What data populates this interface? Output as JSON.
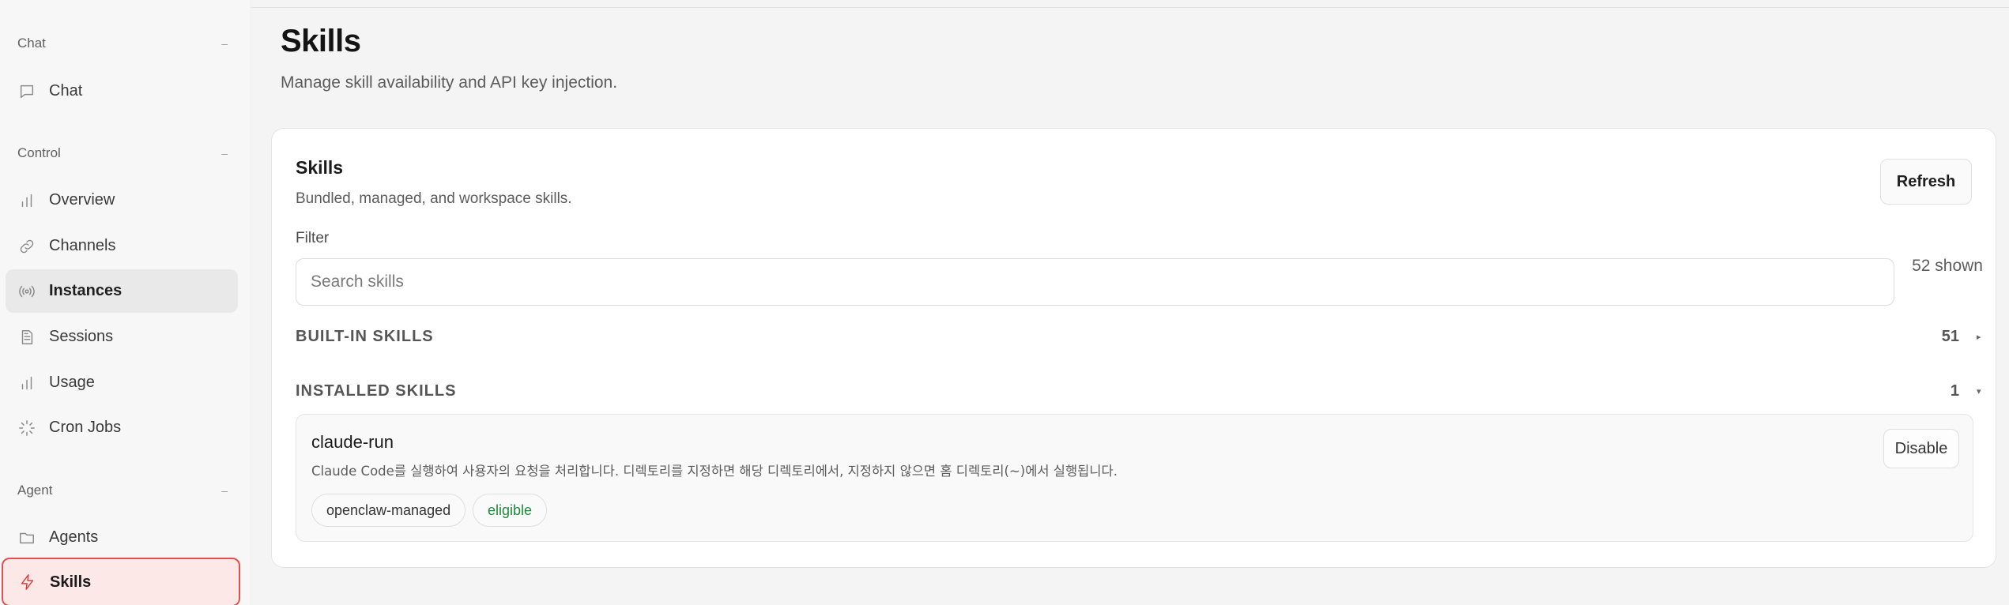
{
  "sidebar": {
    "groups": {
      "chat": {
        "label": "Chat",
        "toggle": "–"
      },
      "control": {
        "label": "Control",
        "toggle": "–"
      },
      "agent": {
        "label": "Agent",
        "toggle": "–"
      }
    },
    "items": {
      "chat": {
        "label": "Chat",
        "icon": "message-icon"
      },
      "overview": {
        "label": "Overview",
        "icon": "bar-chart-icon"
      },
      "channels": {
        "label": "Channels",
        "icon": "link-icon"
      },
      "instances": {
        "label": "Instances",
        "icon": "radio-icon"
      },
      "sessions": {
        "label": "Sessions",
        "icon": "document-icon"
      },
      "usage": {
        "label": "Usage",
        "icon": "bar-chart-icon"
      },
      "cron_jobs": {
        "label": "Cron Jobs",
        "icon": "loader-icon"
      },
      "agents": {
        "label": "Agents",
        "icon": "folder-icon"
      },
      "skills": {
        "label": "Skills",
        "icon": "bolt-icon"
      }
    },
    "selected": "instances",
    "active": "skills",
    "accent_color": "#e0504f"
  },
  "page": {
    "title": "Skills",
    "subtitle": "Manage skill availability and API key injection."
  },
  "card": {
    "title": "Skills",
    "subtitle": "Bundled, managed, and workspace skills.",
    "refresh_label": "Refresh",
    "filter_label": "Filter",
    "search_placeholder": "Search skills",
    "shown_count": "52 shown",
    "sections": {
      "builtin": {
        "title": "BUILT-IN SKILLS",
        "count": "51",
        "expanded_indicator": "▸"
      },
      "installed": {
        "title": "INSTALLED SKILLS",
        "count": "1",
        "expanded_indicator": "▾"
      }
    },
    "skill": {
      "name": "claude-run",
      "description": "Claude Code를 실행하여 사용자의 요청을 처리합니다. 디렉토리를 지정하면 해당 디렉토리에서, 지정하지 않으면 홈 디렉토리(~)에서 실행됩니다.",
      "source_badge": "openclaw-managed",
      "status_badge": "eligible",
      "status_color": "#1e8a3a",
      "disable_label": "Disable"
    }
  }
}
